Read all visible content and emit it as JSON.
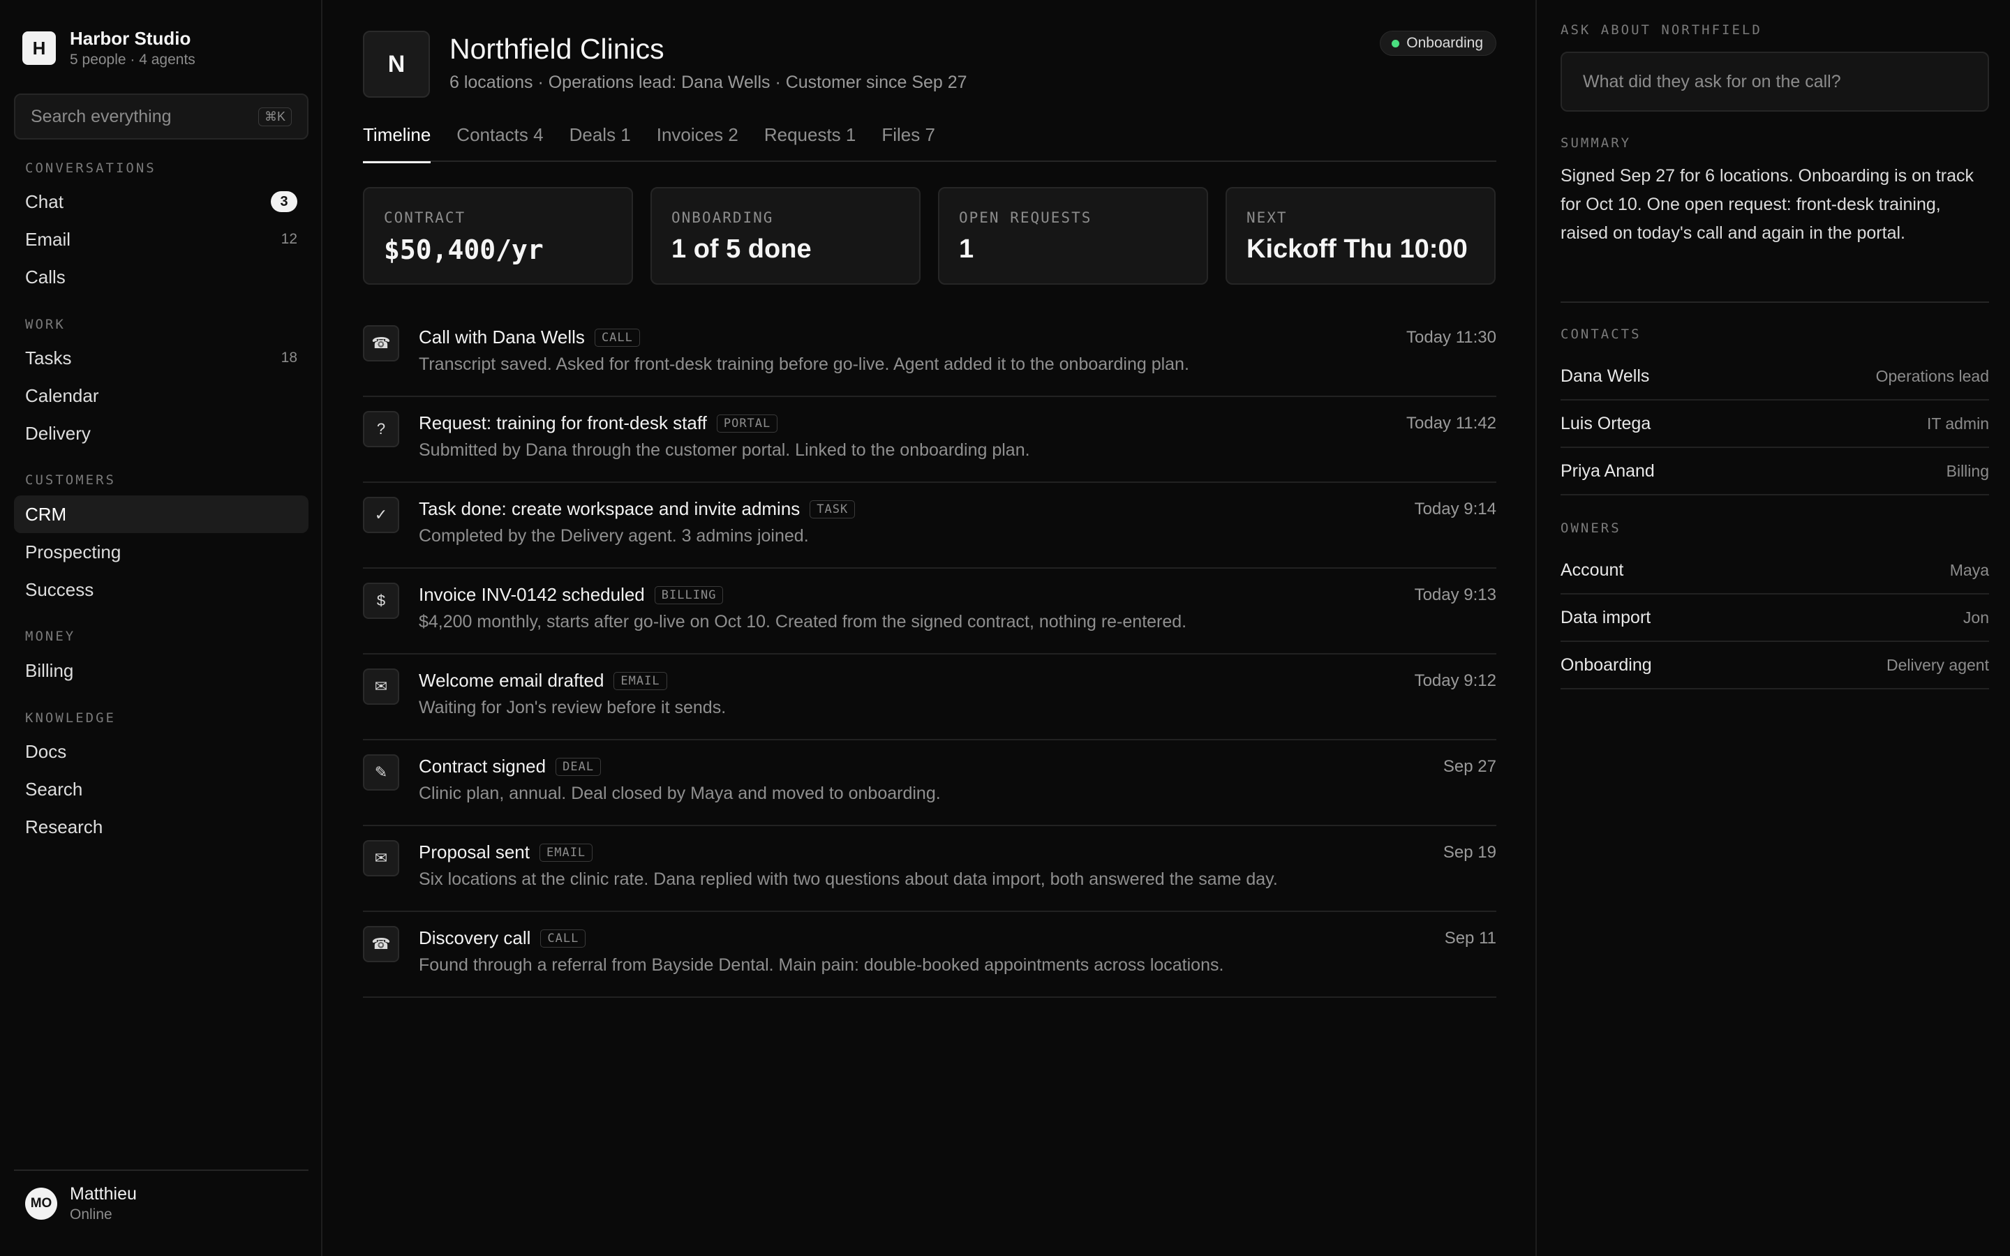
{
  "workspace": {
    "logo_letter": "H",
    "name": "Harbor Studio",
    "subtitle": "5 people · 4 agents"
  },
  "search": {
    "placeholder": "Search everything",
    "shortcut": "⌘K"
  },
  "nav": {
    "conversations": {
      "title": "CONVERSATIONS",
      "items": [
        {
          "label": "Chat",
          "badge": "3"
        },
        {
          "label": "Email",
          "count": "12"
        },
        {
          "label": "Calls"
        }
      ]
    },
    "work": {
      "title": "WORK",
      "items": [
        {
          "label": "Tasks",
          "count": "18"
        },
        {
          "label": "Calendar"
        },
        {
          "label": "Delivery"
        }
      ]
    },
    "customers": {
      "title": "CUSTOMERS",
      "items": [
        {
          "label": "CRM",
          "active": true
        },
        {
          "label": "Prospecting"
        },
        {
          "label": "Success"
        }
      ]
    },
    "money": {
      "title": "MONEY",
      "items": [
        {
          "label": "Billing"
        }
      ]
    },
    "knowledge": {
      "title": "KNOWLEDGE",
      "items": [
        {
          "label": "Docs"
        },
        {
          "label": "Search"
        },
        {
          "label": "Research"
        }
      ]
    }
  },
  "user": {
    "initials": "MO",
    "name": "Matthieu",
    "status": "Online"
  },
  "account": {
    "logo_letter": "N",
    "name": "Northfield Clinics",
    "subtitle": "6 locations · Operations lead: Dana Wells · Customer since Sep 27",
    "status": "Onboarding",
    "status_color": "#4ade80"
  },
  "tabs": [
    "Timeline",
    "Contacts 4",
    "Deals 1",
    "Invoices 2",
    "Requests 1",
    "Files 7"
  ],
  "stats": [
    {
      "label": "CONTRACT",
      "value": "$50,400/yr"
    },
    {
      "label": "ONBOARDING",
      "value": "1 of 5 done"
    },
    {
      "label": "OPEN REQUESTS",
      "value": "1"
    },
    {
      "label": "NEXT",
      "value": "Kickoff Thu 10:00"
    }
  ],
  "timeline": [
    {
      "icon": "☎",
      "icon_name": "phone-icon",
      "title": "Call with Dana Wells",
      "tag": "CALL",
      "time": "Today 11:30",
      "desc": "Transcript saved. Asked for front-desk training before go-live. Agent added it to the onboarding plan."
    },
    {
      "icon": "?",
      "icon_name": "question-icon",
      "title": "Request: training for front-desk staff",
      "tag": "PORTAL",
      "time": "Today 11:42",
      "desc": "Submitted by Dana through the customer portal. Linked to the onboarding plan."
    },
    {
      "icon": "✓",
      "icon_name": "check-icon",
      "title": "Task done: create workspace and invite admins",
      "tag": "TASK",
      "time": "Today 9:14",
      "desc": "Completed by the Delivery agent. 3 admins joined."
    },
    {
      "icon": "$",
      "icon_name": "dollar-icon",
      "title": "Invoice INV-0142 scheduled",
      "tag": "BILLING",
      "time": "Today 9:13",
      "desc": "$4,200 monthly, starts after go-live on Oct 10. Created from the signed contract, nothing re-entered."
    },
    {
      "icon": "✉",
      "icon_name": "mail-icon",
      "title": "Welcome email drafted",
      "tag": "EMAIL",
      "time": "Today 9:12",
      "desc": "Waiting for Jon's review before it sends."
    },
    {
      "icon": "✎",
      "icon_name": "pen-icon",
      "title": "Contract signed",
      "tag": "DEAL",
      "time": "Sep 27",
      "desc": "Clinic plan, annual. Deal closed by Maya and moved to onboarding."
    },
    {
      "icon": "✉",
      "icon_name": "mail-icon",
      "title": "Proposal sent",
      "tag": "EMAIL",
      "time": "Sep 19",
      "desc": "Six locations at the clinic rate. Dana replied with two questions about data import, both answered the same day."
    },
    {
      "icon": "☎",
      "icon_name": "phone-icon",
      "title": "Discovery call",
      "tag": "CALL",
      "time": "Sep 11",
      "desc": "Found through a referral from Bayside Dental. Main pain: double-booked appointments across locations."
    }
  ],
  "panel": {
    "ask_label": "ASK ABOUT NORTHFIELD",
    "ask_placeholder": "What did they ask for on the call?",
    "summary_label": "SUMMARY",
    "summary": "Signed Sep 27 for 6 locations. Onboarding is on track for Oct 10. One open request: front-desk training, raised on today's call and again in the portal.",
    "contacts_label": "CONTACTS",
    "contacts": [
      {
        "name": "Dana Wells",
        "role": "Operations lead"
      },
      {
        "name": "Luis Ortega",
        "role": "IT admin"
      },
      {
        "name": "Priya Anand",
        "role": "Billing"
      }
    ],
    "owners_label": "OWNERS",
    "owners": [
      {
        "name": "Account",
        "role": "Maya"
      },
      {
        "name": "Data import",
        "role": "Jon"
      },
      {
        "name": "Onboarding",
        "role": "Delivery agent"
      }
    ]
  }
}
